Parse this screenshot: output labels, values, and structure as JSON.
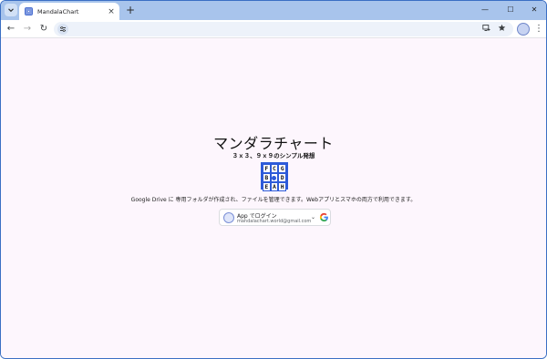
{
  "browser": {
    "tab_title": "MandalaChart",
    "tab_close": "×",
    "new_tab": "+",
    "minimize": "—",
    "maximize": "☐",
    "close": "✕",
    "back": "←",
    "forward": "→",
    "reload": "↻",
    "kebab": "⋮"
  },
  "page": {
    "title": "マンダラチャート",
    "subtitle": "３ｘ３、９ｘ９のシンプル発想",
    "logo_letters": [
      "F",
      "C",
      "G",
      "B",
      "",
      "D",
      "E",
      "A",
      "H"
    ],
    "description": "Google Drive に 専用フォルダが作成され、ファイルを管理できます。Webアプリとスマホの両方で利用できます。",
    "login": {
      "label": "App でログイン",
      "email": "mandalachart.world@gmail.com",
      "caret": "⌄"
    }
  },
  "colors": {
    "accent": "#2d5ad8",
    "tab_strip": "#a8c4ec",
    "page_bg": "#fdf6fd"
  }
}
